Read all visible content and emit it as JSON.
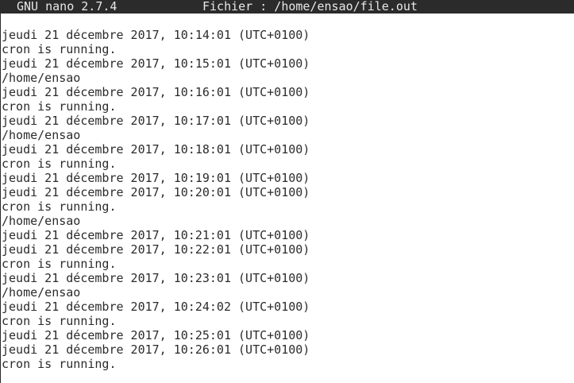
{
  "titlebar": {
    "app": "GNU nano 2.7.4",
    "file": "Fichier : /home/ensao/file.out"
  },
  "buffer": {
    "lines": [
      "jeudi 21 décembre 2017, 10:14:01 (UTC+0100)",
      "cron is running.",
      "jeudi 21 décembre 2017, 10:15:01 (UTC+0100)",
      "/home/ensao",
      "jeudi 21 décembre 2017, 10:16:01 (UTC+0100)",
      "cron is running.",
      "jeudi 21 décembre 2017, 10:17:01 (UTC+0100)",
      "/home/ensao",
      "jeudi 21 décembre 2017, 10:18:01 (UTC+0100)",
      "cron is running.",
      "jeudi 21 décembre 2017, 10:19:01 (UTC+0100)",
      "jeudi 21 décembre 2017, 10:20:01 (UTC+0100)",
      "cron is running.",
      "/home/ensao",
      "jeudi 21 décembre 2017, 10:21:01 (UTC+0100)",
      "jeudi 21 décembre 2017, 10:22:01 (UTC+0100)",
      "cron is running.",
      "jeudi 21 décembre 2017, 10:23:01 (UTC+0100)",
      "/home/ensao",
      "jeudi 21 décembre 2017, 10:24:02 (UTC+0100)",
      "cron is running.",
      "jeudi 21 décembre 2017, 10:25:01 (UTC+0100)",
      "jeudi 21 décembre 2017, 10:26:01 (UTC+0100)",
      "cron is running."
    ]
  }
}
